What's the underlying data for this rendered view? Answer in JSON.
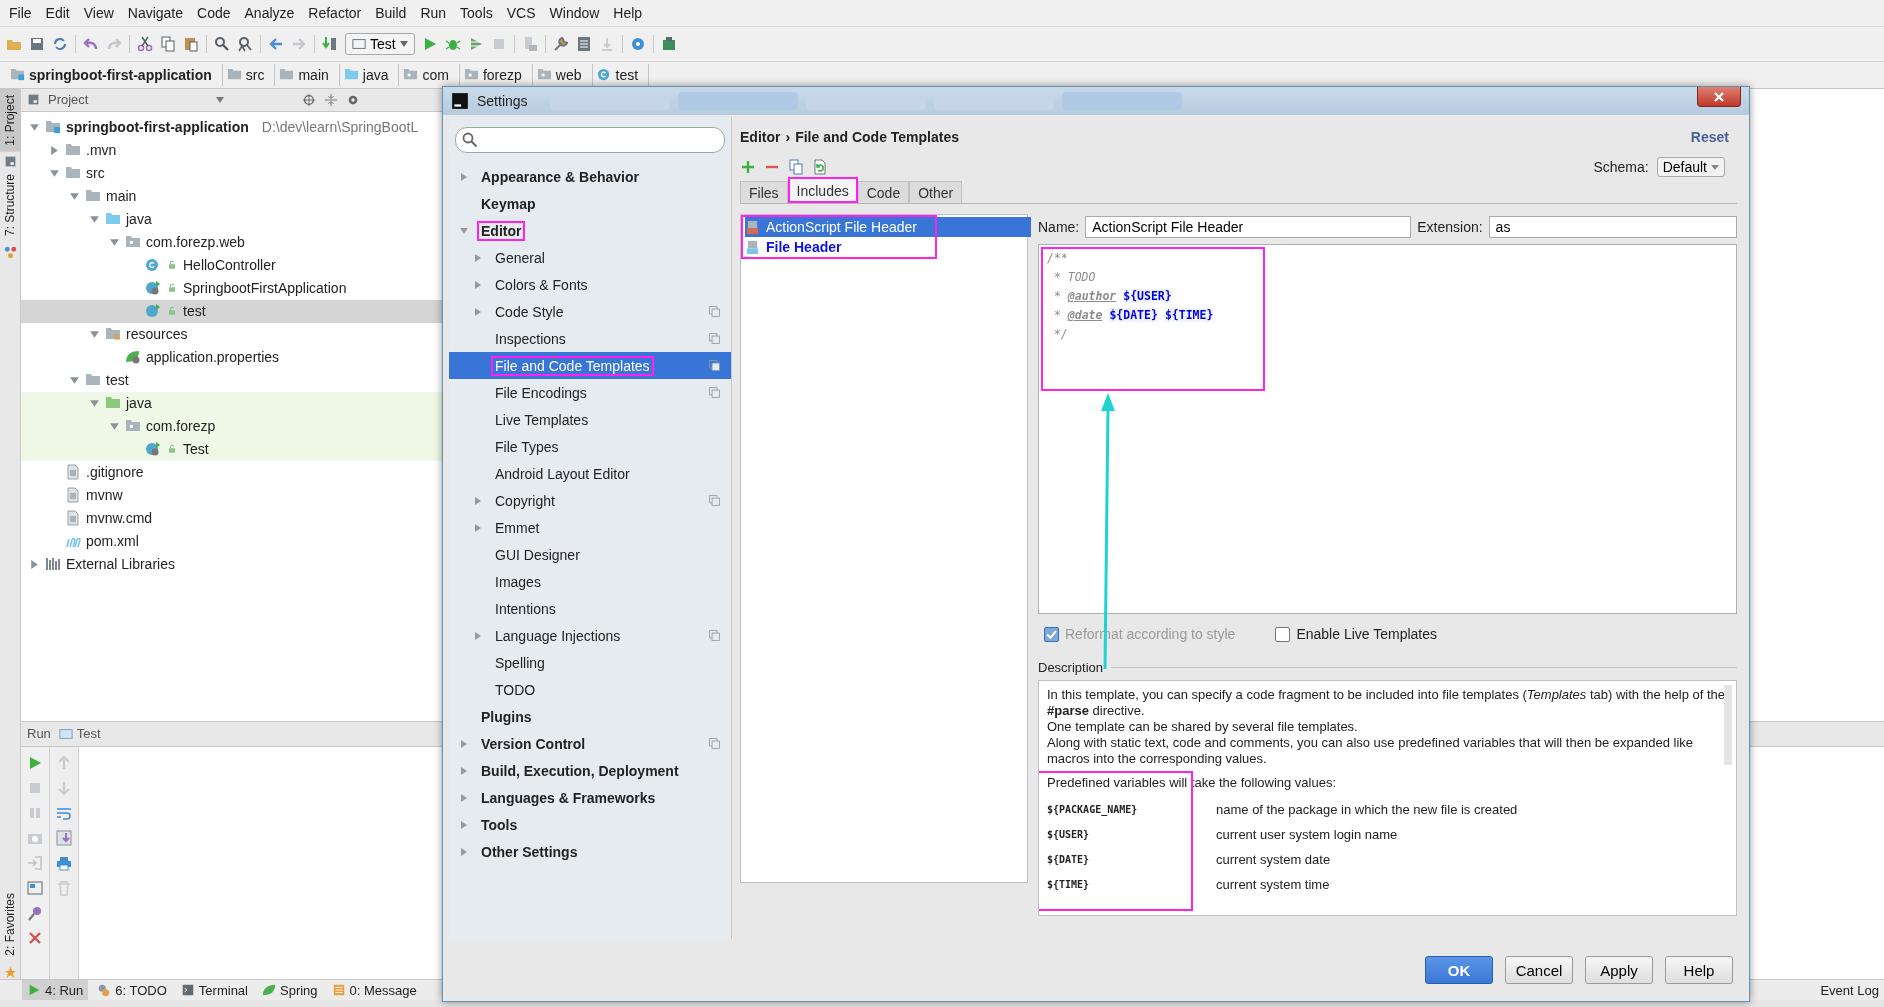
{
  "menu": [
    "File",
    "Edit",
    "View",
    "Navigate",
    "Code",
    "Analyze",
    "Refactor",
    "Build",
    "Run",
    "Tools",
    "VCS",
    "Window",
    "Help"
  ],
  "toolbar": {
    "run_config": "Test"
  },
  "breadcrumb": [
    {
      "label": "springboot-first-application",
      "kind": "module"
    },
    {
      "label": "src",
      "kind": "folder"
    },
    {
      "label": "main",
      "kind": "folder"
    },
    {
      "label": "java",
      "kind": "src_folder"
    },
    {
      "label": "com",
      "kind": "package"
    },
    {
      "label": "forezp",
      "kind": "package"
    },
    {
      "label": "web",
      "kind": "package"
    },
    {
      "label": "test",
      "kind": "class"
    }
  ],
  "side_tabs": [
    {
      "label": "1: Project",
      "selected": true,
      "kind": "project"
    },
    {
      "label": "7: Structure",
      "selected": false,
      "kind": "structure"
    }
  ],
  "favorites_tab": {
    "label": "2: Favorites"
  },
  "project": {
    "title": "Project",
    "tree": [
      {
        "label": "springboot-first-application",
        "path": "D:\\dev\\learn\\SpringBootL",
        "kind": "module",
        "expanded": true,
        "selected": false,
        "children": [
          {
            "label": ".mvn",
            "kind": "folder",
            "expanded": false,
            "selected": false
          },
          {
            "label": "src",
            "kind": "folder",
            "expanded": true,
            "selected": false,
            "children": [
              {
                "label": "main",
                "kind": "folder",
                "expanded": true,
                "selected": false,
                "children": [
                  {
                    "label": "java",
                    "kind": "src_folder",
                    "expanded": true,
                    "selected": false,
                    "children": [
                      {
                        "label": "com.forezp.web",
                        "kind": "package",
                        "expanded": true,
                        "selected": false,
                        "children": [
                          {
                            "label": "HelloController",
                            "kind": "class",
                            "selected": false
                          },
                          {
                            "label": "SpringbootFirstApplication",
                            "kind": "spring_class",
                            "selected": false
                          },
                          {
                            "label": "test",
                            "kind": "run_class",
                            "selected": true
                          }
                        ]
                      }
                    ]
                  },
                  {
                    "label": "resources",
                    "kind": "resources",
                    "expanded": true,
                    "selected": false,
                    "children": [
                      {
                        "label": "application.properties",
                        "kind": "properties",
                        "selected": false
                      }
                    ]
                  }
                ]
              },
              {
                "label": "test",
                "kind": "folder",
                "expanded": true,
                "selected": false,
                "children": [
                  {
                    "label": "java",
                    "kind": "test_folder",
                    "expanded": true,
                    "selected": false,
                    "tinted": true,
                    "children": [
                      {
                        "label": "com.forezp",
                        "kind": "package",
                        "expanded": true,
                        "selected": false,
                        "children": [
                          {
                            "label": "Test",
                            "kind": "spring_class",
                            "selected": false
                          }
                        ]
                      }
                    ]
                  }
                ]
              }
            ]
          },
          {
            "label": ".gitignore",
            "kind": "file",
            "selected": false
          },
          {
            "label": "mvnw",
            "kind": "file",
            "selected": false
          },
          {
            "label": "mvnw.cmd",
            "kind": "file",
            "selected": false
          },
          {
            "label": "pom.xml",
            "kind": "maven",
            "selected": false
          }
        ]
      },
      {
        "label": "External Libraries",
        "kind": "libraries",
        "expanded": false,
        "selected": false
      }
    ]
  },
  "run_panel": {
    "title": "Run",
    "tab": "Test"
  },
  "bottom_tabs": [
    {
      "label": "4: Run",
      "kind": "run",
      "selected": true
    },
    {
      "label": "6: TODO",
      "kind": "todo",
      "selected": false
    },
    {
      "label": "Terminal",
      "kind": "terminal",
      "selected": false
    },
    {
      "label": "Spring",
      "kind": "spring",
      "selected": false
    },
    {
      "label": "0: Message",
      "kind": "messages",
      "selected": false
    }
  ],
  "event_log": "Event Log",
  "dialog": {
    "title": "Settings",
    "nav": [
      {
        "label": "Appearance & Behavior",
        "expandable": true,
        "expanded": false,
        "selected": false,
        "highlighted": false,
        "scoped": false
      },
      {
        "label": "Keymap",
        "expandable": false,
        "selected": false,
        "highlighted": false,
        "scoped": false
      },
      {
        "label": "Editor",
        "expandable": true,
        "expanded": true,
        "selected": false,
        "highlighted": true,
        "scoped": false,
        "children": [
          {
            "label": "General",
            "expandable": true,
            "expanded": false,
            "selected": false,
            "highlighted": false,
            "scoped": false
          },
          {
            "label": "Colors & Fonts",
            "expandable": true,
            "expanded": false,
            "selected": false,
            "highlighted": false,
            "scoped": false
          },
          {
            "label": "Code Style",
            "expandable": true,
            "expanded": false,
            "selected": false,
            "highlighted": false,
            "scoped": true
          },
          {
            "label": "Inspections",
            "expandable": false,
            "selected": false,
            "highlighted": false,
            "scoped": true
          },
          {
            "label": "File and Code Templates",
            "expandable": false,
            "selected": true,
            "highlighted": true,
            "scoped": true
          },
          {
            "label": "File Encodings",
            "expandable": false,
            "selected": false,
            "highlighted": false,
            "scoped": true
          },
          {
            "label": "Live Templates",
            "expandable": false,
            "selected": false,
            "highlighted": false,
            "scoped": false
          },
          {
            "label": "File Types",
            "expandable": false,
            "selected": false,
            "highlighted": false,
            "scoped": false
          },
          {
            "label": "Android Layout Editor",
            "expandable": false,
            "selected": false,
            "highlighted": false,
            "scoped": false
          },
          {
            "label": "Copyright",
            "expandable": true,
            "expanded": false,
            "selected": false,
            "highlighted": false,
            "scoped": true
          },
          {
            "label": "Emmet",
            "expandable": true,
            "expanded": false,
            "selected": false,
            "highlighted": false,
            "scoped": false
          },
          {
            "label": "GUI Designer",
            "expandable": false,
            "selected": false,
            "highlighted": false,
            "scoped": false
          },
          {
            "label": "Images",
            "expandable": false,
            "selected": false,
            "highlighted": false,
            "scoped": false
          },
          {
            "label": "Intentions",
            "expandable": false,
            "selected": false,
            "highlighted": false,
            "scoped": false
          },
          {
            "label": "Language Injections",
            "expandable": true,
            "expanded": false,
            "selected": false,
            "highlighted": false,
            "scoped": true
          },
          {
            "label": "Spelling",
            "expandable": false,
            "selected": false,
            "highlighted": false,
            "scoped": false
          },
          {
            "label": "TODO",
            "expandable": false,
            "selected": false,
            "highlighted": false,
            "scoped": false
          }
        ]
      },
      {
        "label": "Plugins",
        "expandable": false,
        "selected": false,
        "highlighted": false,
        "scoped": false
      },
      {
        "label": "Version Control",
        "expandable": true,
        "expanded": false,
        "selected": false,
        "highlighted": false,
        "scoped": true
      },
      {
        "label": "Build, Execution, Deployment",
        "expandable": true,
        "expanded": false,
        "selected": false,
        "highlighted": false,
        "scoped": false
      },
      {
        "label": "Languages & Frameworks",
        "expandable": true,
        "expanded": false,
        "selected": false,
        "highlighted": false,
        "scoped": false
      },
      {
        "label": "Tools",
        "expandable": true,
        "expanded": false,
        "selected": false,
        "highlighted": false,
        "scoped": false
      },
      {
        "label": "Other Settings",
        "expandable": true,
        "expanded": false,
        "selected": false,
        "highlighted": false,
        "scoped": false
      }
    ],
    "path": [
      "Editor",
      "File and Code Templates"
    ],
    "separator": "›",
    "reset": "Reset",
    "schema": {
      "label": "Schema:",
      "value": "Default"
    },
    "tabs": [
      {
        "label": "Files",
        "selected": false,
        "highlighted": false
      },
      {
        "label": "Includes",
        "selected": true,
        "highlighted": true
      },
      {
        "label": "Code",
        "selected": false,
        "highlighted": false
      },
      {
        "label": "Other",
        "selected": false,
        "highlighted": false
      }
    ],
    "templates": {
      "highlighted": true,
      "items": [
        {
          "label": "ActionScript File Header",
          "kind": "actionscript",
          "selected": true,
          "modified": false
        },
        {
          "label": "File Header",
          "kind": "java",
          "selected": false,
          "modified": true
        }
      ]
    },
    "name": {
      "label": "Name:",
      "value": "ActionScript File Header"
    },
    "extension": {
      "label": "Extension:",
      "value": "as"
    },
    "code": {
      "highlighted": true,
      "lines": [
        [
          {
            "text": "/**",
            "kind": "comment"
          }
        ],
        [
          {
            "text": " * TODO",
            "kind": "comment"
          }
        ],
        [
          {
            "text": " * ",
            "kind": "comment"
          },
          {
            "text": "@author",
            "kind": "tag"
          },
          {
            "text": "${USER}",
            "kind": "variable"
          }
        ],
        [
          {
            "text": " * ",
            "kind": "comment"
          },
          {
            "text": "@date",
            "kind": "tag"
          },
          {
            "text": "${DATE}",
            "kind": "variable"
          },
          {
            "text": "${TIME}",
            "kind": "variable"
          }
        ],
        [
          {
            "text": " */",
            "kind": "comment"
          }
        ]
      ]
    },
    "options": [
      {
        "label": "Reformat according to style",
        "checked": true,
        "disabled": true
      },
      {
        "label": "Enable Live Templates",
        "checked": false,
        "disabled": false
      }
    ],
    "description": {
      "heading": "Description",
      "paragraphs": [
        "In this template, you can specify a code fragment to be included into file templates (*Templates* tab) with the help of the **#parse** directive.",
        "One template can be shared by several file templates.",
        "Along with static text, code and comments, you can also use predefined variables that will then be expanded like macros into the corresponding values."
      ],
      "intro": "Predefined variables will take the following values:",
      "highlighted": true,
      "variables": [
        {
          "name": "${PACKAGE_NAME}",
          "meaning": "name of the package in which the new file is created"
        },
        {
          "name": "${USER}",
          "meaning": "current user system login name"
        },
        {
          "name": "${DATE}",
          "meaning": "current system date"
        },
        {
          "name": "${TIME}",
          "meaning": "current system time"
        }
      ]
    },
    "buttons": [
      {
        "label": "OK",
        "kind": "primary"
      },
      {
        "label": "Cancel",
        "kind": "normal"
      },
      {
        "label": "Apply",
        "kind": "normal"
      },
      {
        "label": "Help",
        "kind": "normal"
      }
    ]
  }
}
